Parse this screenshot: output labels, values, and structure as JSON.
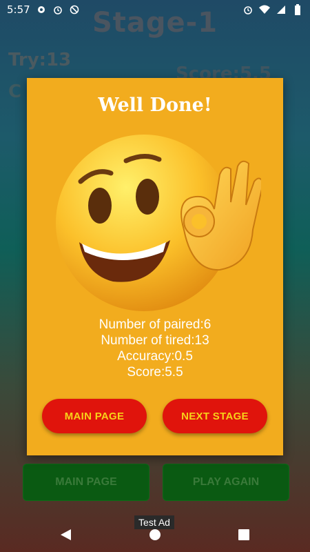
{
  "status_bar": {
    "time": "5:57",
    "left_icons": [
      "gear-icon",
      "alarm-icon",
      "no-sync-icon"
    ],
    "right_icons": [
      "alarm-icon",
      "wifi-icon",
      "signal-icon",
      "battery-icon"
    ]
  },
  "background": {
    "stage_title": "Stage-1",
    "try_text": "Try:13",
    "score_text": "Score:5.5",
    "partial_text": "C",
    "buttons": {
      "main_page": "MAIN PAGE",
      "play_again": "PLAY AGAIN"
    }
  },
  "dialog": {
    "title": "Well Done!",
    "emoji": "ok-hand-smiley-icon",
    "stats": {
      "paired": "Number of paired:6",
      "tired": "Number of tired:13",
      "accuracy": "Accuracy:0.5",
      "score": "Score:5.5"
    },
    "buttons": {
      "main_page": "MAIN PAGE",
      "next_stage": "NEXT STAGE"
    }
  },
  "ad_label": "Test Ad",
  "nav_bar": {
    "icons": [
      "back-icon",
      "home-icon",
      "recents-icon"
    ]
  },
  "colors": {
    "dialog_bg": "#f2ac1e",
    "button_red": "#e0140c",
    "button_text": "#f7d21a",
    "bg_button_green": "#0a5a12"
  }
}
